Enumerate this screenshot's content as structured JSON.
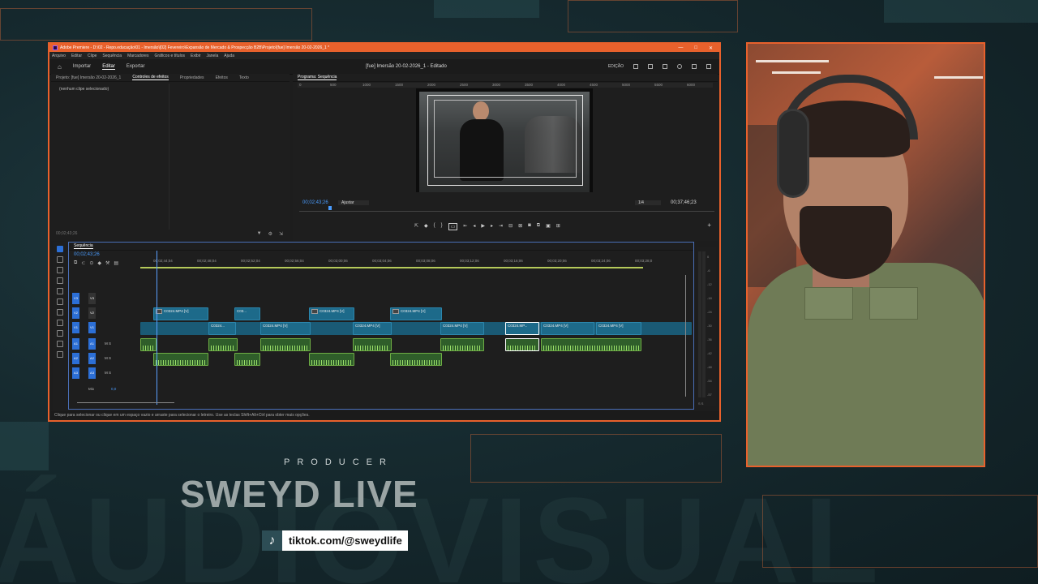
{
  "window": {
    "title": "Adobe Premiere - D:\\02 - Repo.educação\\01 - Imersão\\[02] Fevereiro\\Expansão de Mercado & Prospecção B2B\\Projeto\\[fue] Imersão 20-02-2026_1 *",
    "controls": [
      "—",
      "□",
      "✕"
    ]
  },
  "menu": [
    "Arquivo",
    "Editar",
    "Clipe",
    "Sequência",
    "Marcadores",
    "Gráficos e títulos",
    "Exibir",
    "Janela",
    "Ajuda"
  ],
  "header": {
    "tabs": [
      "Importar",
      "Editar",
      "Exportar"
    ],
    "active_tab": "Editar",
    "document": "[fue] Imersão 20-02-2026_1 - Editado",
    "workspace": "EDIÇÃO"
  },
  "source_panel": {
    "tabs": [
      "Projeto: [fue] Imersão 20-02-2026_1",
      "Controles de efeitos",
      "Propriedades",
      "Efeitos",
      "Texto"
    ],
    "active_tab": "Controles de efeitos",
    "empty_message": "(nenhum clipe selecionado)",
    "timecode": "00;02;43;26"
  },
  "program_panel": {
    "title": "Programa: Sequência",
    "ruler_ticks": [
      "0",
      "500",
      "1000",
      "1500",
      "2000",
      "2500",
      "3000",
      "3500",
      "4000",
      "4500",
      "5000",
      "5500",
      "6000"
    ],
    "timecode": "00;02;43;26",
    "fit": "Ajustar",
    "resolution": "1/4",
    "duration": "00;37;46;23"
  },
  "timeline": {
    "tab": "Sequência",
    "timecode": "00;02;43;26",
    "ruler": [
      "00;02;44;04",
      "00;02;48;04",
      "00;02;52;04",
      "00;02;56;04",
      "00;03;00;06",
      "00;03;04;06",
      "00;03;08;06",
      "00;03;12;06",
      "00;03;16;06",
      "00;03;20;06",
      "00;03;24;06",
      "00;03;28;0"
    ],
    "tracks": [
      "V3",
      "V2",
      "V1",
      "A1",
      "A2",
      "A3"
    ],
    "mix_label": "Mix",
    "mix_value": "0,0",
    "clips_v2": [
      "C0324.MP4 [V]",
      "C03...",
      "C0324.MP4 [V]",
      "C0324.MP4 [V]"
    ],
    "clips_v1": [
      "C0324...",
      "C0324.MP4 [V]",
      "C0324.MP4 [V]",
      "C0324.MP4 [V]",
      "C0324.MP...",
      "C0324.MP4 [V]",
      "C0324.MP4 [V]"
    ]
  },
  "meters": {
    "scale": [
      "0",
      "-6",
      "-12",
      "-18",
      "-24",
      "-30",
      "-36",
      "-42",
      "-48",
      "-54",
      "-57"
    ],
    "bottom": "S S"
  },
  "status": "Clique para selecionar ou clique em um espaço vazio e arraste para selecionar o letreiro. Use as teclas Shift+Alt+Ctrl para obter mais opções.",
  "branding": {
    "producer": "PRODUCER",
    "title": "SWEYD LIVE",
    "background_word": "ÁUDIOVISUAL",
    "tiktok": "tiktok.com/@sweydlife",
    "tiktok_icon": "tiktok-icon"
  },
  "colors": {
    "accent": "#e8612c",
    "clip_video": "#1d6a8a",
    "clip_audio": "#6fae45",
    "selection": "#2c6fd6"
  }
}
